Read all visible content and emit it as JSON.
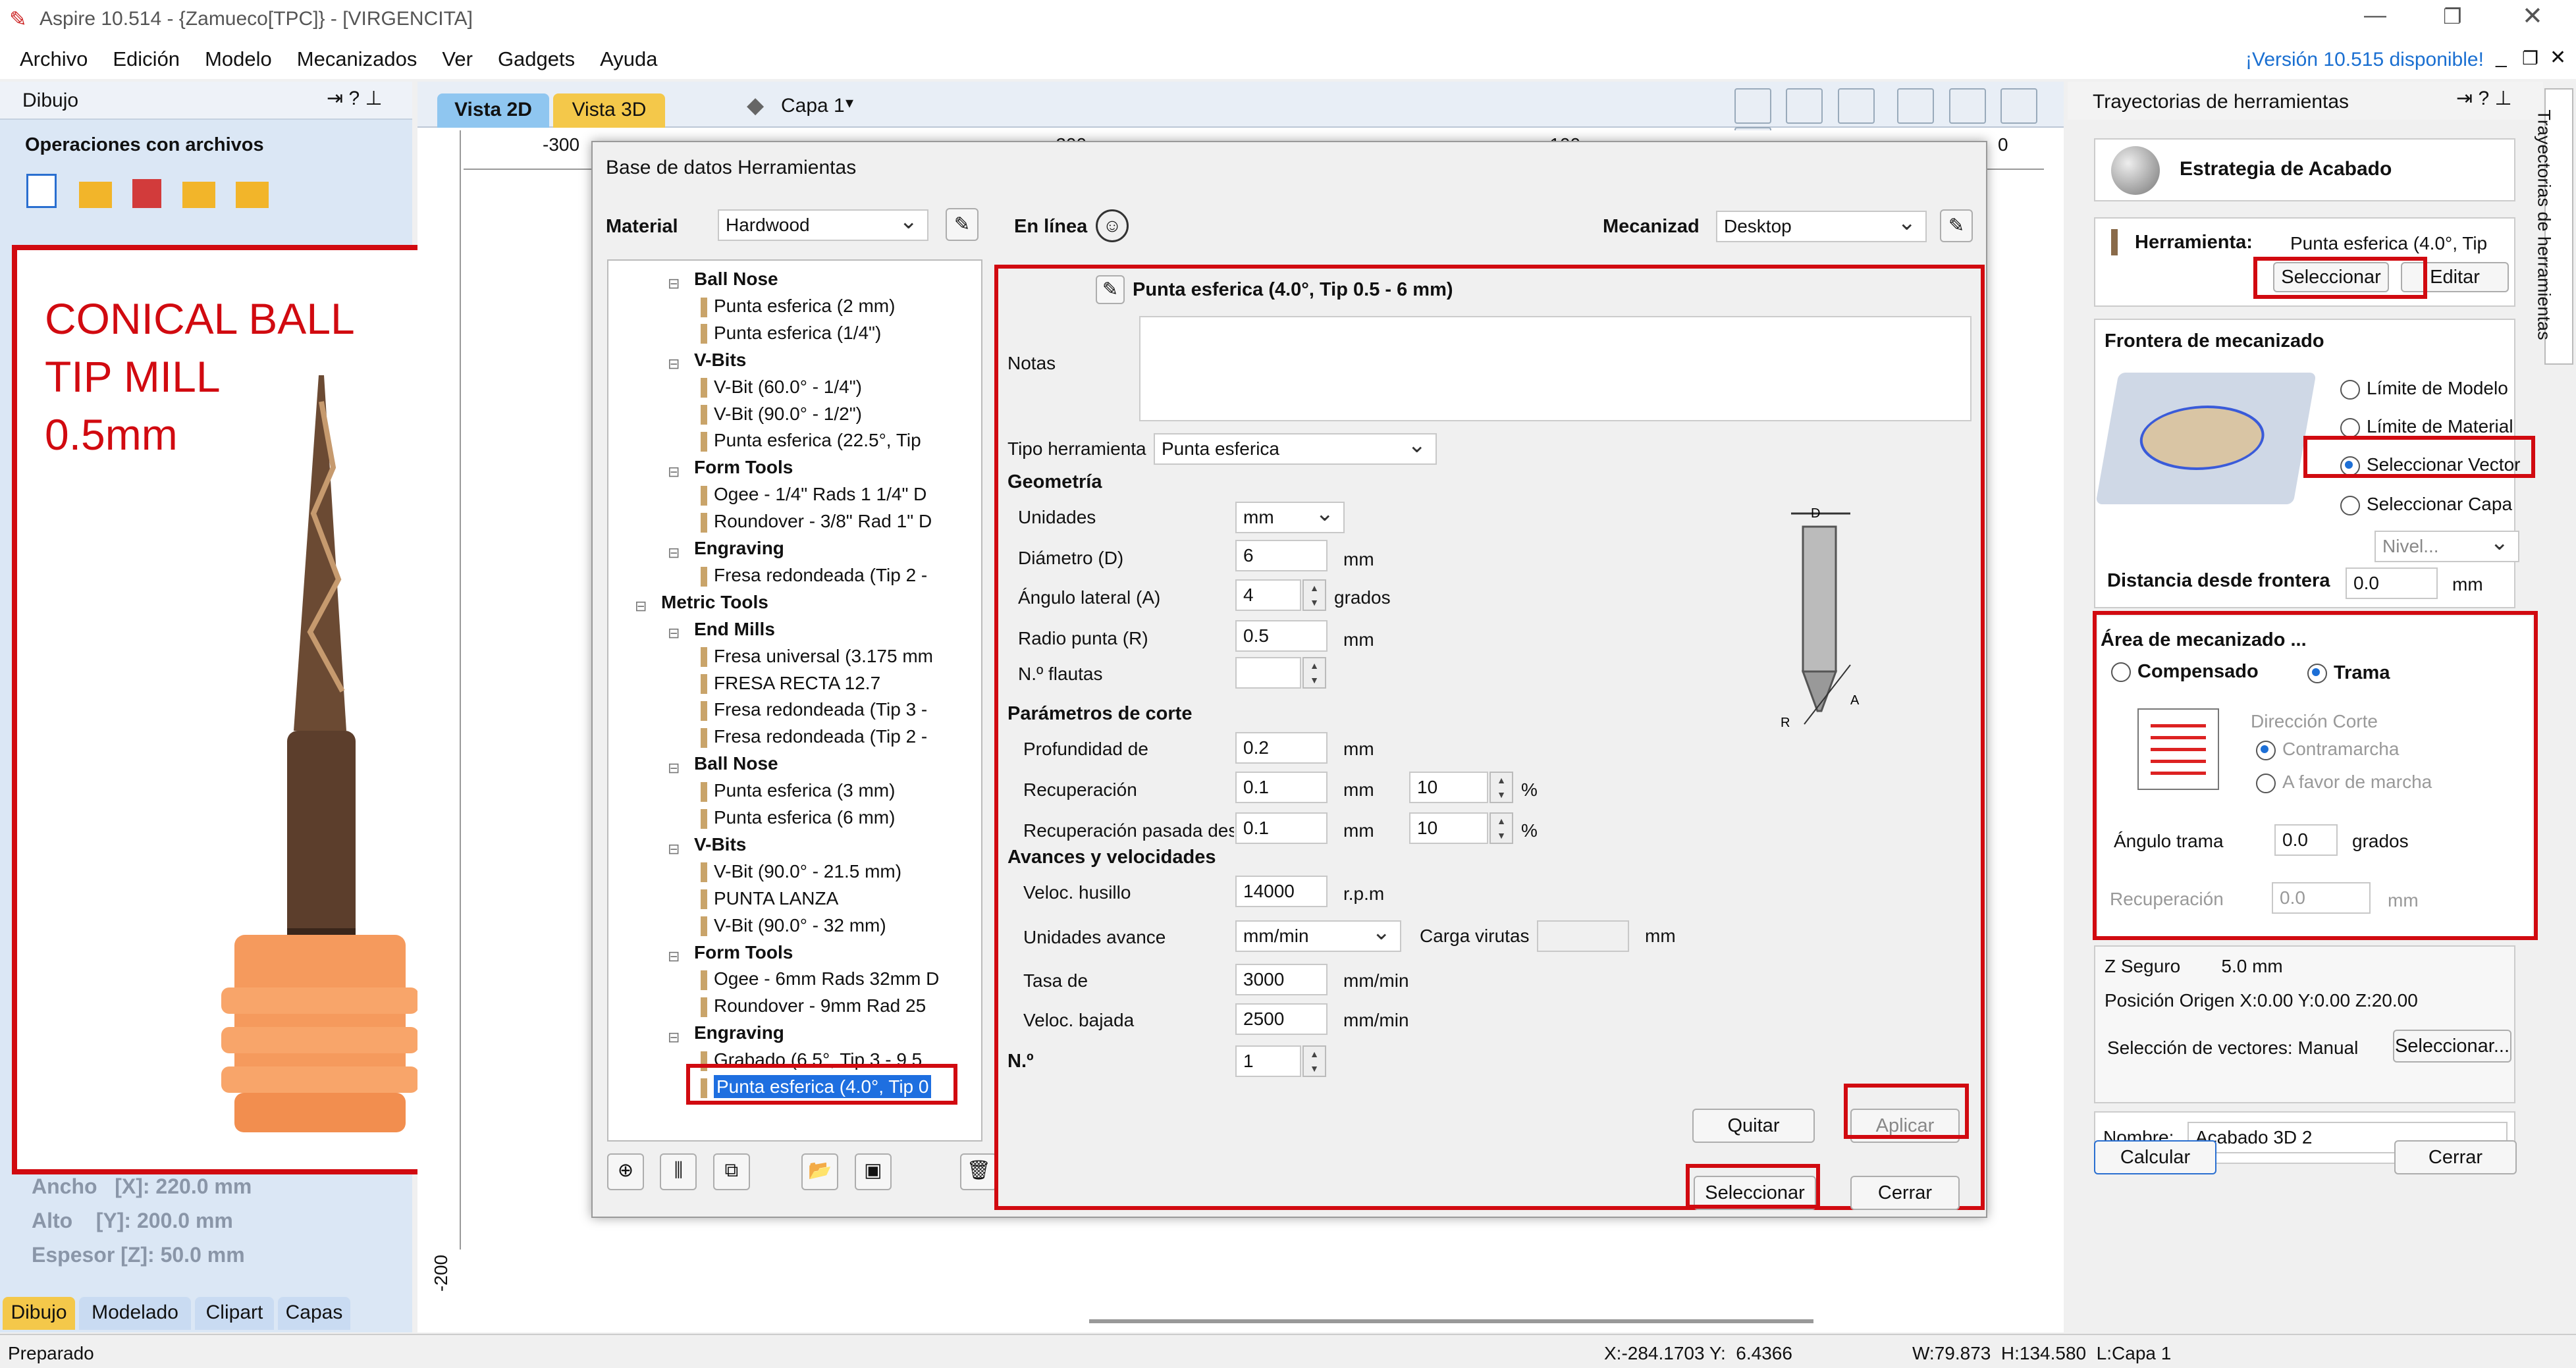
{
  "window": {
    "title": "Aspire 10.514 - {Zamueco[TPC]} - [VIRGENCITA]"
  },
  "menu": [
    "Archivo",
    "Edición",
    "Modelo",
    "Mecanizados",
    "Ver",
    "Gadgets",
    "Ayuda"
  ],
  "update_link": "¡Versión 10.515 disponible!",
  "left_panel": {
    "title": "Dibujo",
    "section": "Operaciones con archivos",
    "dims": {
      "width": "Ancho   [X]: 220.0 mm",
      "height": "Alto    [Y]: 200.0 mm",
      "thickness": "Espesor [Z]: 50.0 mm"
    },
    "tabs": [
      "Dibujo",
      "Modelado",
      "Clipart",
      "Capas"
    ]
  },
  "photo_overlay": {
    "lines": [
      "CONICAL BALL",
      "TIP MILL",
      "0.5mm"
    ]
  },
  "view_tabs": [
    "Vista 2D",
    "Vista 3D"
  ],
  "layer": "Capa 1",
  "ruler": {
    "x_labels": [
      "-300",
      "-200",
      "-100",
      "0"
    ],
    "y_label": "-200"
  },
  "dialog": {
    "title": "Base de datos Herramientas",
    "material_label": "Material",
    "material_value": "Hardwood",
    "online_label": "En línea",
    "machine_label": "Mecanizad",
    "machine_value": "Desktop",
    "tree": [
      {
        "level": 1,
        "text": "Ball Nose",
        "bold": true
      },
      {
        "level": 2,
        "text": "Punta esferica (2 mm)"
      },
      {
        "level": 2,
        "text": "Punta esferica (1/4\")"
      },
      {
        "level": 1,
        "text": "V-Bits",
        "bold": true
      },
      {
        "level": 2,
        "text": "V-Bit (60.0° - 1/4\")"
      },
      {
        "level": 2,
        "text": "V-Bit (90.0° - 1/2\")"
      },
      {
        "level": 2,
        "text": "Punta esferica (22.5°, Tip"
      },
      {
        "level": 1,
        "text": "Form Tools",
        "bold": true
      },
      {
        "level": 2,
        "text": "Ogee - 1/4\" Rads 1 1/4\" D"
      },
      {
        "level": 2,
        "text": "Roundover - 3/8\" Rad 1\" D"
      },
      {
        "level": 1,
        "text": "Engraving",
        "bold": true
      },
      {
        "level": 2,
        "text": "Fresa redondeada (Tip 2 -"
      },
      {
        "level": 0,
        "text": "Metric Tools",
        "bold": true
      },
      {
        "level": 1,
        "text": "End Mills",
        "bold": true
      },
      {
        "level": 2,
        "text": "Fresa universal (3.175 mm"
      },
      {
        "level": 2,
        "text": "FRESA RECTA 12.7"
      },
      {
        "level": 2,
        "text": "Fresa redondeada (Tip 3 -"
      },
      {
        "level": 2,
        "text": "Fresa redondeada (Tip 2 -"
      },
      {
        "level": 1,
        "text": "Ball Nose",
        "bold": true
      },
      {
        "level": 2,
        "text": "Punta esferica (3 mm)"
      },
      {
        "level": 2,
        "text": "Punta esferica (6 mm)"
      },
      {
        "level": 1,
        "text": "V-Bits",
        "bold": true
      },
      {
        "level": 2,
        "text": "V-Bit (90.0° - 21.5 mm)"
      },
      {
        "level": 2,
        "text": "PUNTA LANZA"
      },
      {
        "level": 2,
        "text": "V-Bit (90.0° - 32 mm)"
      },
      {
        "level": 1,
        "text": "Form Tools",
        "bold": true
      },
      {
        "level": 2,
        "text": "Ogee - 6mm Rads 32mm D"
      },
      {
        "level": 2,
        "text": "Roundover - 9mm Rad 25"
      },
      {
        "level": 1,
        "text": "Engraving",
        "bold": true
      },
      {
        "level": 2,
        "text": "Grabado (6.5°, Tip 3 - 9.5"
      },
      {
        "level": 2,
        "text": "Punta esferica (4.0°, Tip 0",
        "selected": true
      }
    ],
    "tool_name": "Punta esferica (4.0°, Tip 0.5 - 6 mm)",
    "notes_label": "Notas",
    "tool_type_label": "Tipo herramienta",
    "tool_type_value": "Punta esferica",
    "geometry": {
      "title": "Geometría",
      "units_label": "Unidades",
      "units_value": "mm",
      "diameter_label": "Diámetro (D)",
      "diameter_value": "6",
      "diameter_unit": "mm",
      "angle_label": "Ángulo lateral (A)",
      "angle_value": "4",
      "angle_unit": "grados",
      "tip_label": "Radio punta (R)",
      "tip_value": "0.5",
      "tip_unit": "mm",
      "flutes_label": "N.º flautas",
      "flutes_value": ""
    },
    "cutting": {
      "title": "Parámetros de corte",
      "depth_label": "Profundidad de",
      "depth_value": "0.2",
      "depth_unit": "mm",
      "stepover_label": "Recuperación",
      "stepover_value": "0.1",
      "stepover_unit": "mm",
      "stepover_pct": "10",
      "pct": "%",
      "finish_label": "Recuperación pasada desb",
      "finish_value": "0.1",
      "finish_unit": "mm",
      "finish_pct": "10"
    },
    "feeds": {
      "title": "Avances y velocidades",
      "spindle_label": "Veloc. husillo",
      "spindle_value": "14000",
      "spindle_unit": "r.p.m",
      "feed_units_label": "Unidades avance",
      "feed_units_value": "mm/min",
      "chip_label": "Carga virutas",
      "chip_unit": "mm",
      "feed_label": "Tasa de",
      "feed_value": "3000",
      "feed_unit": "mm/min",
      "plunge_label": "Veloc. bajada",
      "plunge_value": "2500",
      "plunge_unit": "mm/min"
    },
    "number_label": "N.º",
    "number_value": "1",
    "diagram_labels": {
      "d": "D",
      "r": "R",
      "a": "A"
    },
    "buttons": {
      "remove": "Quitar",
      "apply": "Aplicar",
      "select": "Seleccionar",
      "close": "Cerrar"
    }
  },
  "right_panel": {
    "title": "Trayectorias de herramientas",
    "vertical_tab": "Trayectorias de herramientas",
    "strategy": "Estrategia de Acabado",
    "tool_label": "Herramienta:",
    "tool_value": "Punta esferica (4.0°, Tip",
    "select_btn": "Seleccionar",
    "edit_btn": "Editar",
    "boundary_title": "Frontera de mecanizado",
    "boundary_options": [
      "Límite de Modelo",
      "Límite de Material",
      "Seleccionar Vector",
      "Seleccionar Capa"
    ],
    "level_placeholder": "Nivel...",
    "offset_label": "Distancia desde frontera",
    "offset_value": "0.0",
    "offset_unit": "mm",
    "area_title": "Área de mecanizado ...",
    "area_offset": "Compensado",
    "area_raster": "Trama",
    "direction_label": "Dirección Corte",
    "climb": "Contramarcha",
    "conventional": "A favor de marcha",
    "raster_angle_label": "Ángulo trama",
    "raster_angle_value": "0.0",
    "raster_angle_unit": "grados",
    "stepover_label": "Recuperación",
    "stepover_value": "0.0",
    "stepover_unit": "mm",
    "safe_z": "Z Seguro        5.0 mm",
    "origin": "Posición Origen X:0.00 Y:0.00 Z:20.00",
    "vector_sel": "Selección de vectores: Manual",
    "vector_sel_btn": "Seleccionar...",
    "name_label": "Nombre:",
    "name_value": "Acabado 3D 2",
    "calc_btn": "Calcular",
    "close_btn": "Cerrar"
  },
  "status": {
    "ready": "Preparado",
    "coords": "X:-284.1703 Y:  6.4366",
    "size": "W:79.873  H:134.580  L:Capa 1"
  }
}
